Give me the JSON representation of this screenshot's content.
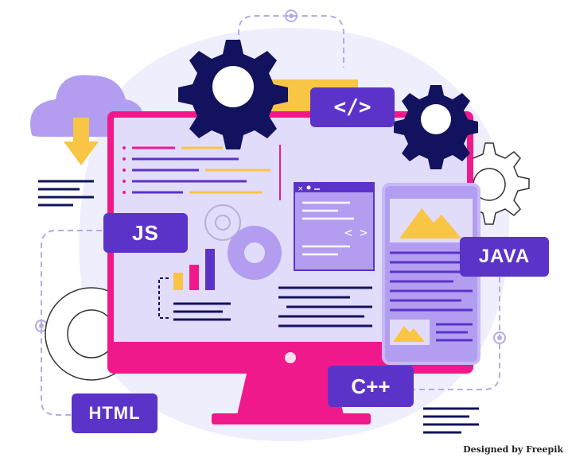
{
  "labels": {
    "js": "JS",
    "java": "JAVA",
    "cpp": "C++",
    "html": "HTML",
    "code": "</>"
  },
  "credit": "Designed by Freepik",
  "colors": {
    "purple_dark": "#5b33c9",
    "purple_light": "#ddd4ff",
    "purple_mid": "#b39df0",
    "pink": "#f0198c",
    "navy": "#12125e",
    "yellow": "#f8c544",
    "bg_blob": "#efeefc"
  },
  "icons": [
    "cloud-download-icon",
    "gear-icon",
    "folder-icon",
    "code-window-icon",
    "phone-icon",
    "bar-chart-icon",
    "image-icon"
  ]
}
